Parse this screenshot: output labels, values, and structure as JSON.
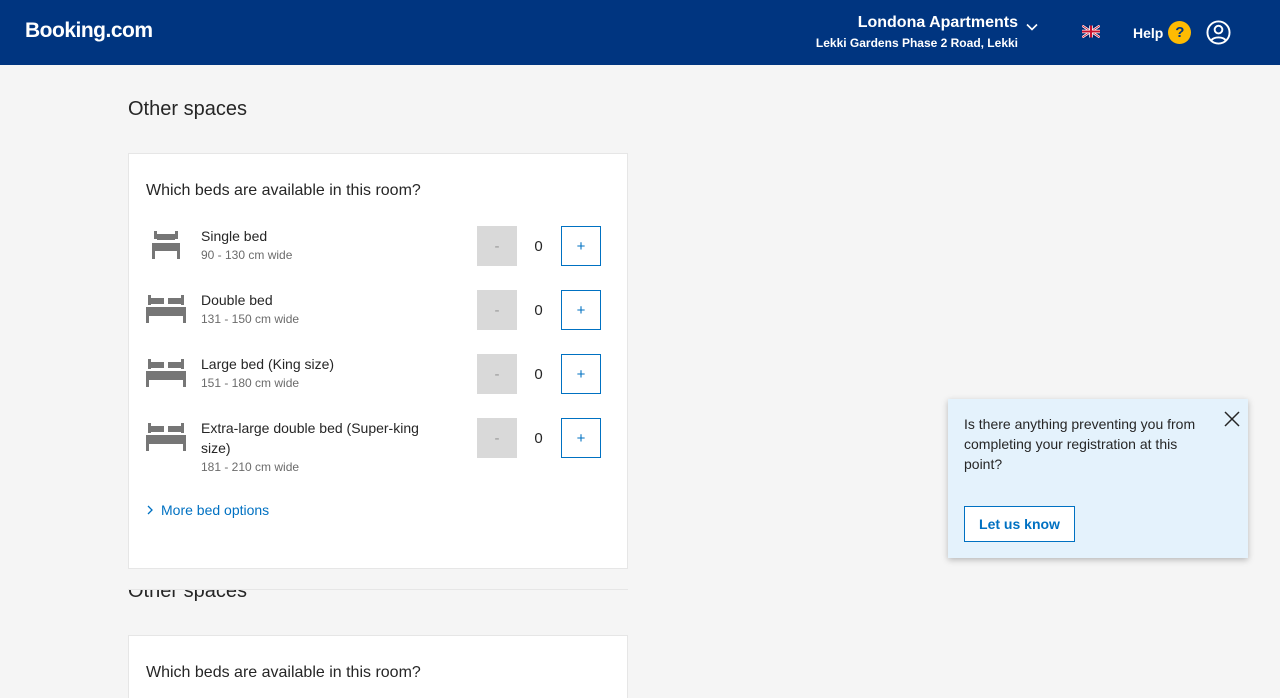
{
  "header": {
    "logo": "Booking.com",
    "property_name": "Londona Apartments",
    "property_address": "Lekki Gardens Phase 2 Road, Lekki",
    "help_label": "Help",
    "help_icon_glyph": "?"
  },
  "sections": [
    {
      "title": "Other spaces",
      "question": "Which beds are available in this room?",
      "beds": [
        {
          "name": "Single bed",
          "size": "90 - 130 cm wide",
          "count": "0",
          "minus": "-",
          "plus": "+"
        },
        {
          "name": "Double bed",
          "size": "131 - 150 cm wide",
          "count": "0",
          "minus": "-",
          "plus": "+"
        },
        {
          "name": "Large bed (King size)",
          "size": "151 - 180 cm wide",
          "count": "0",
          "minus": "-",
          "plus": "+"
        },
        {
          "name": "Extra-large double bed (Super-king size)",
          "size": "181 - 210 cm wide",
          "count": "0",
          "minus": "-",
          "plus": "+"
        }
      ],
      "more_label": "More bed options"
    },
    {
      "title": "Other spaces",
      "question": "Which beds are available in this room?"
    }
  ],
  "feedback": {
    "message": "Is there anything preventing you from completing your registration at this point?",
    "button_label": "Let us know"
  },
  "colors": {
    "brand": "#003580",
    "link": "#0071c2",
    "help_badge": "#febb02",
    "feedback_bg": "#e4f2fc"
  }
}
